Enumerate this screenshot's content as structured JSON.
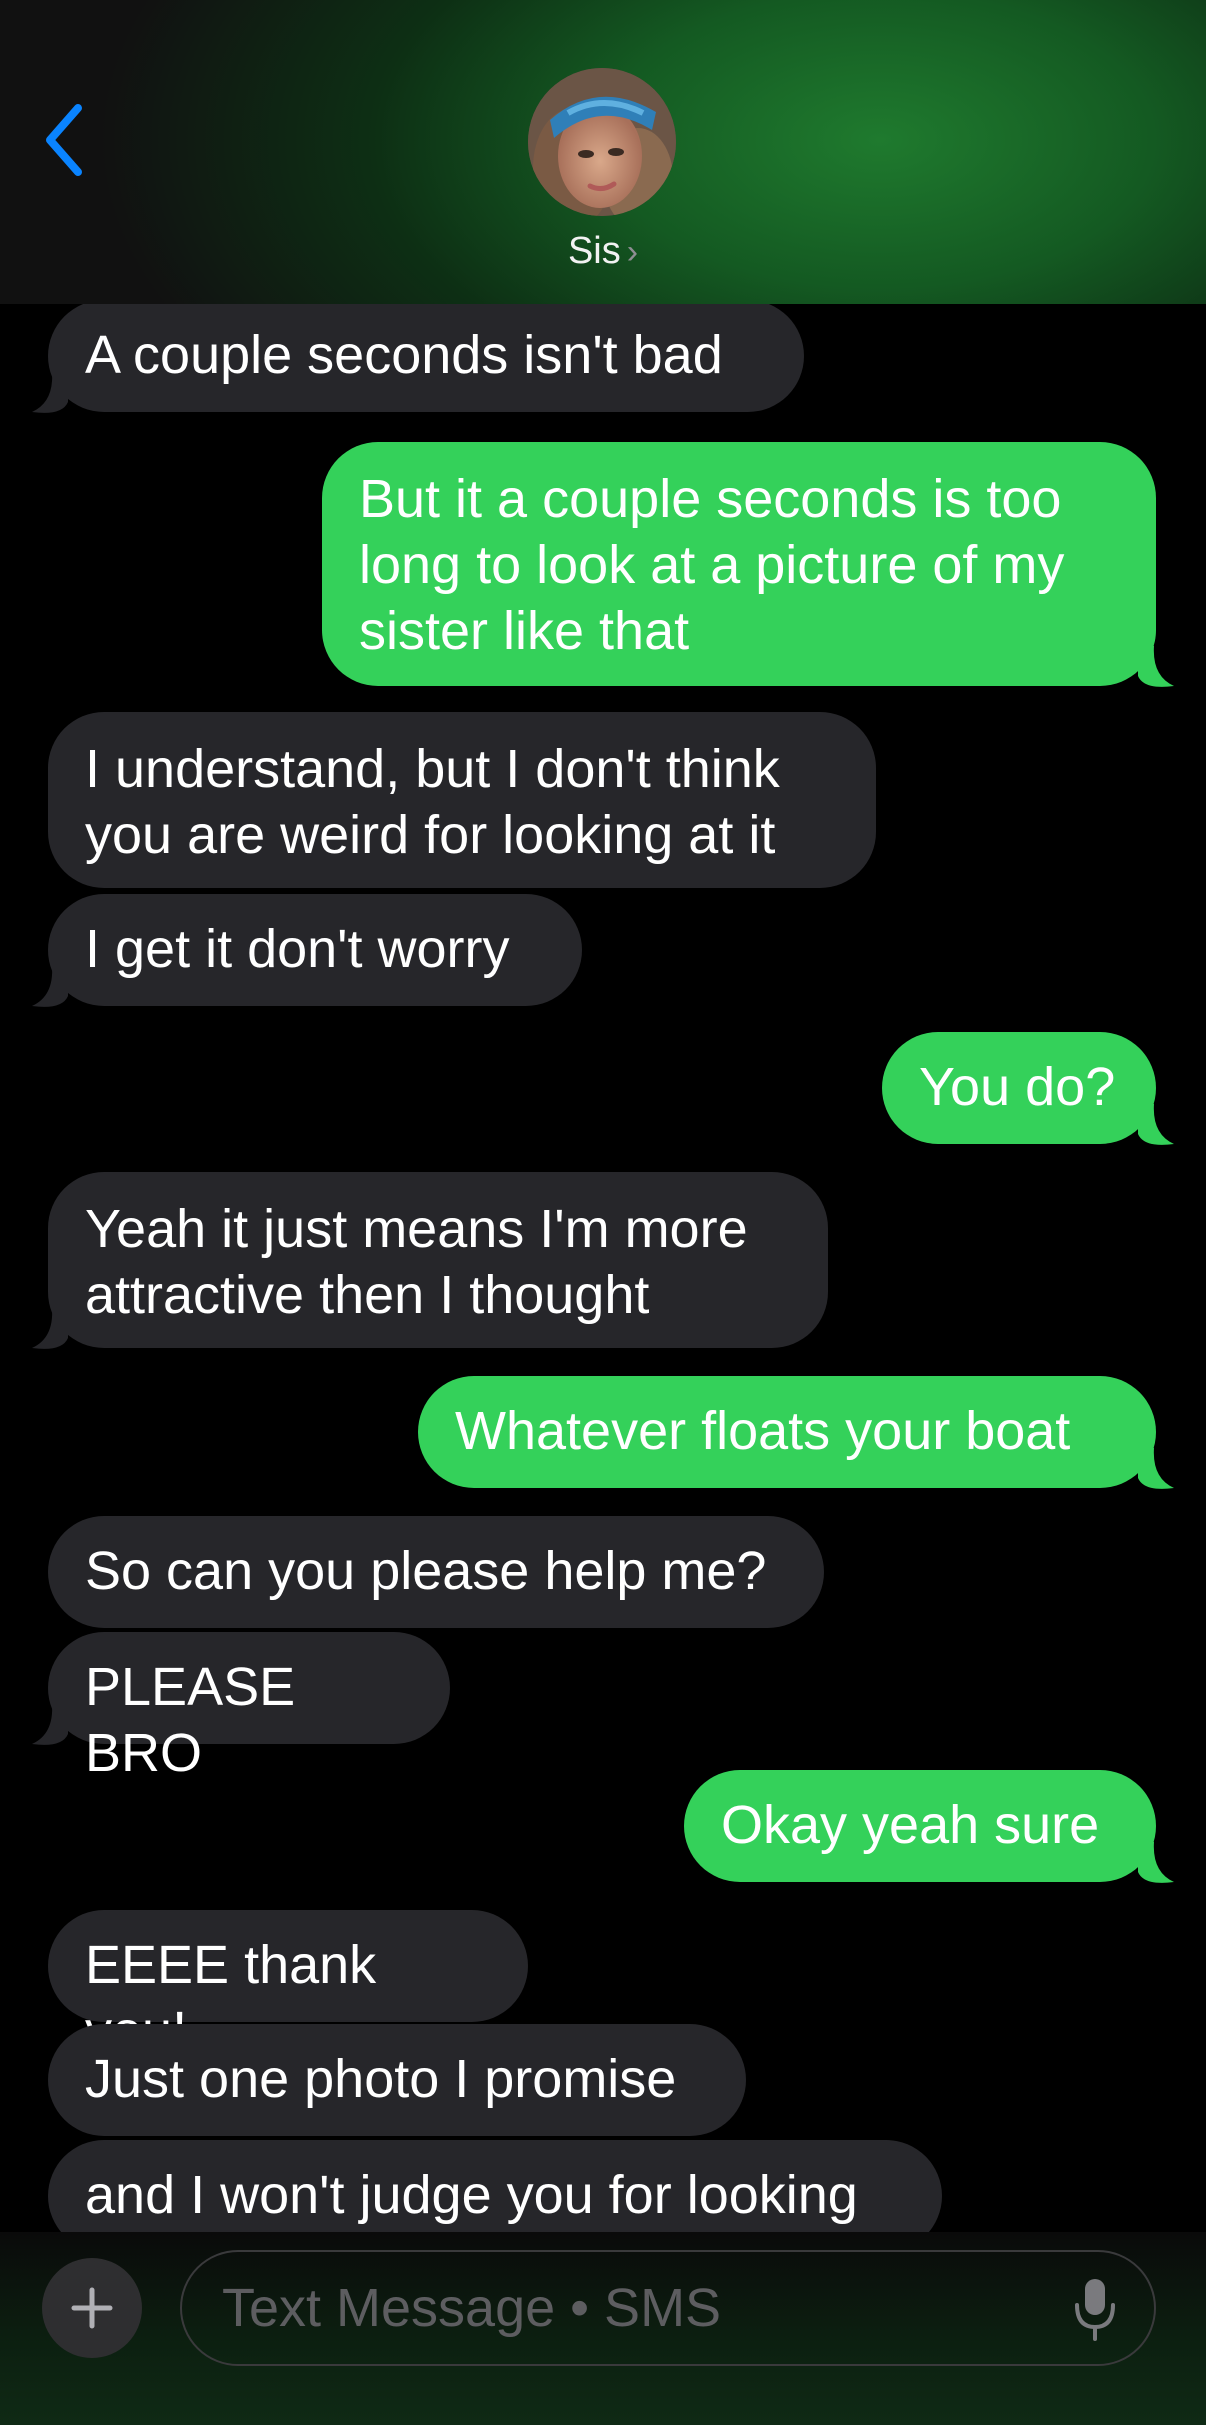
{
  "header": {
    "contact_name": "Sis",
    "chevron": "›",
    "icons": {
      "back": "chevron-left-icon",
      "avatar": "avatar"
    }
  },
  "messages": [
    {
      "direction": "received",
      "text": "A couple seconds isn't bad"
    },
    {
      "direction": "sent",
      "text": "But it a couple seconds is too long to look at a picture of my sister like that"
    },
    {
      "direction": "received",
      "text": "I understand, but I don't think you are weird for looking at it"
    },
    {
      "direction": "received",
      "text": "I get it don't worry"
    },
    {
      "direction": "sent",
      "text": "You do?"
    },
    {
      "direction": "received",
      "text": "Yeah it just means I'm more attractive then I thought"
    },
    {
      "direction": "sent",
      "text": "Whatever floats your boat"
    },
    {
      "direction": "received",
      "text": "So can you please help me?"
    },
    {
      "direction": "received",
      "text": "PLEASE BRO"
    },
    {
      "direction": "sent",
      "text": "Okay yeah sure"
    },
    {
      "direction": "received",
      "text": "EEEE thank you!"
    },
    {
      "direction": "received",
      "text": "Just one photo I promise"
    },
    {
      "direction": "received",
      "text": "and I won't judge you for looking"
    }
  ],
  "composer": {
    "placeholder": "Text Message • SMS",
    "plus_icon": "plus-icon",
    "mic_icon": "microphone-icon"
  },
  "colors": {
    "sent_bubble": "#34d15a",
    "received_bubble": "#26262a",
    "accent": "#0a84ff"
  }
}
